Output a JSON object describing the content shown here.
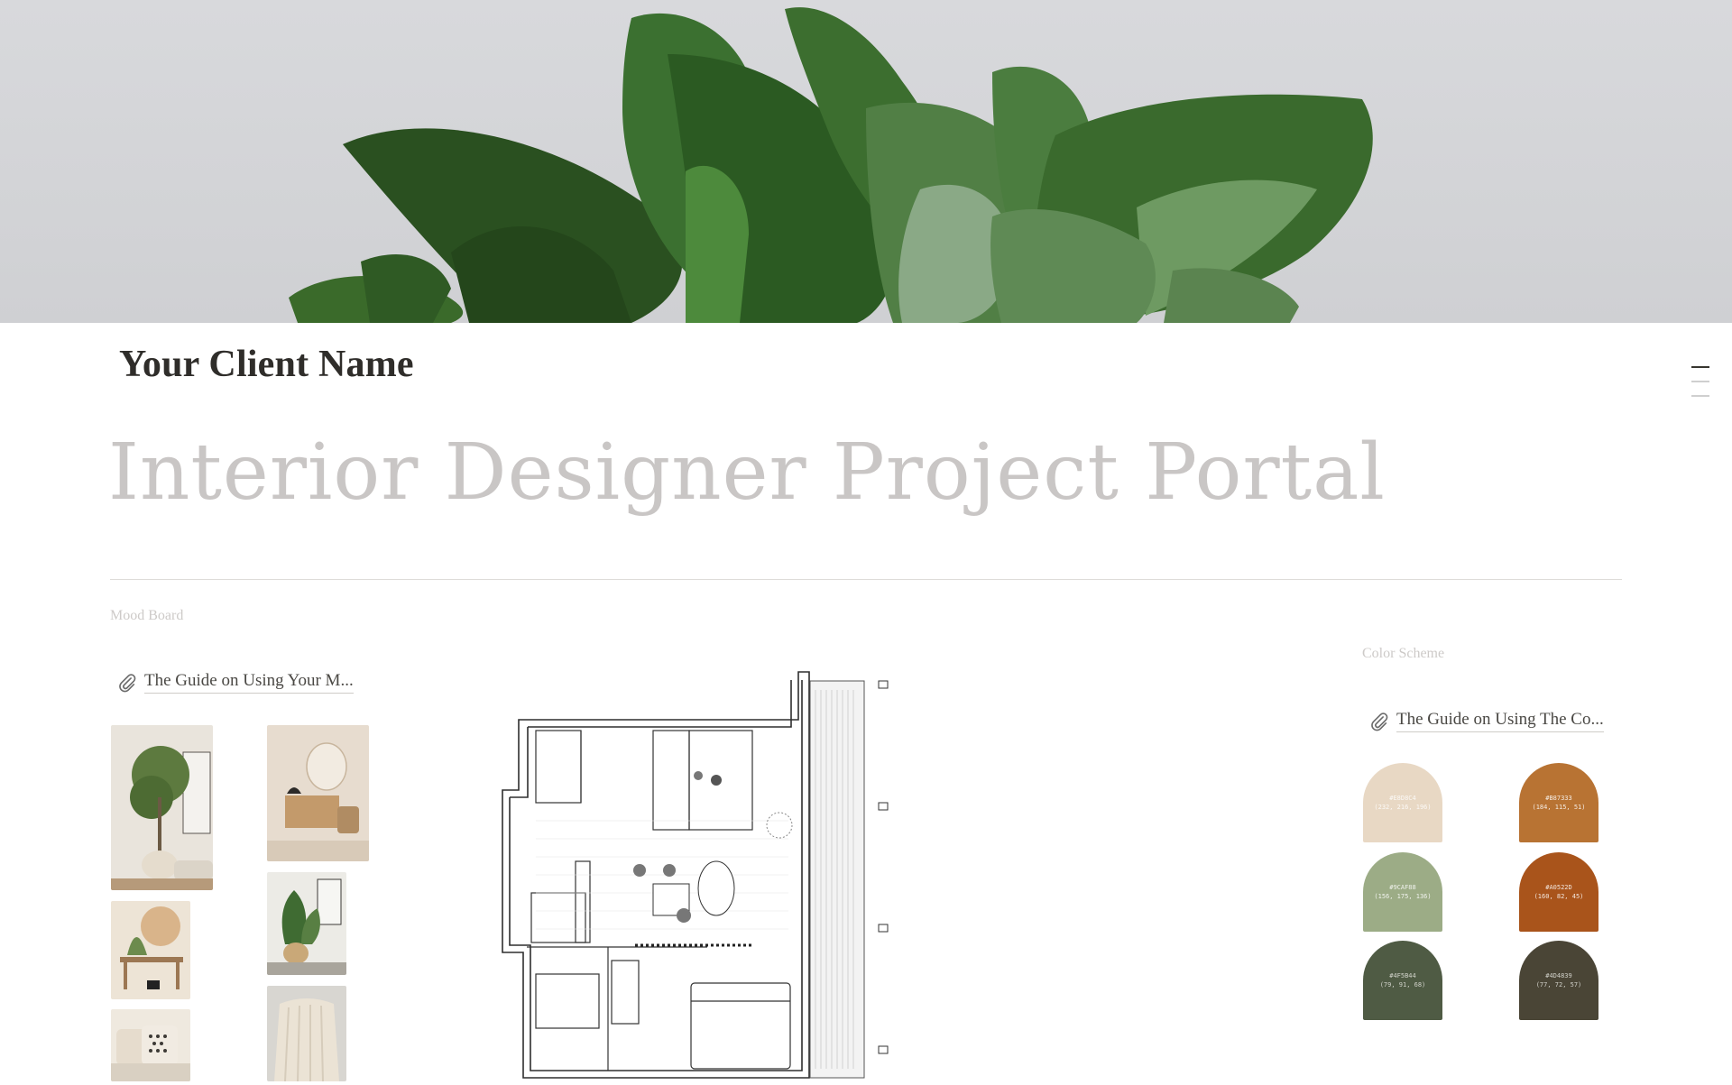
{
  "page": {
    "client_name": "Your Client Name",
    "title": "Interior Designer Project Portal"
  },
  "mood_board": {
    "label": "Mood Board",
    "guide_link": "The Guide on Using Your M..."
  },
  "color_scheme": {
    "label": "Color Scheme",
    "guide_link": "The Guide on Using The Co...",
    "swatches": [
      {
        "hex": "#E8D8C4",
        "rgb": "(232, 216, 196)",
        "color": "#e8d8c4",
        "text_color": "#ffffff"
      },
      {
        "hex": "#B87333",
        "rgb": "(184, 115, 51)",
        "color": "#b87333",
        "text_color": "#ffffff"
      },
      {
        "hex": "#9CAF88",
        "rgb": "(156, 175, 136)",
        "color": "#9cac86",
        "text_color": "#ffffff"
      },
      {
        "hex": "#A0522D",
        "rgb": "(160, 82, 45)",
        "color": "#a9541b",
        "text_color": "#ffffff"
      },
      {
        "hex": "#4F5B44",
        "rgb": "(79, 91, 68)",
        "color": "#4f5b44",
        "text_color": "#e6e6e0"
      },
      {
        "hex": "#4D4839",
        "rgb": "(77, 72, 57)",
        "color": "#4a4536",
        "text_color": "#e6e6e0"
      }
    ]
  },
  "icons": {
    "attachment": "paperclip-icon",
    "toc": "table-of-contents-icon"
  },
  "colors": {
    "title_gray": "#c9c6c5",
    "client_name": "#2f2d2a",
    "leaf_dark": "#2f5a22",
    "cover_bg": "#d6d7da"
  }
}
